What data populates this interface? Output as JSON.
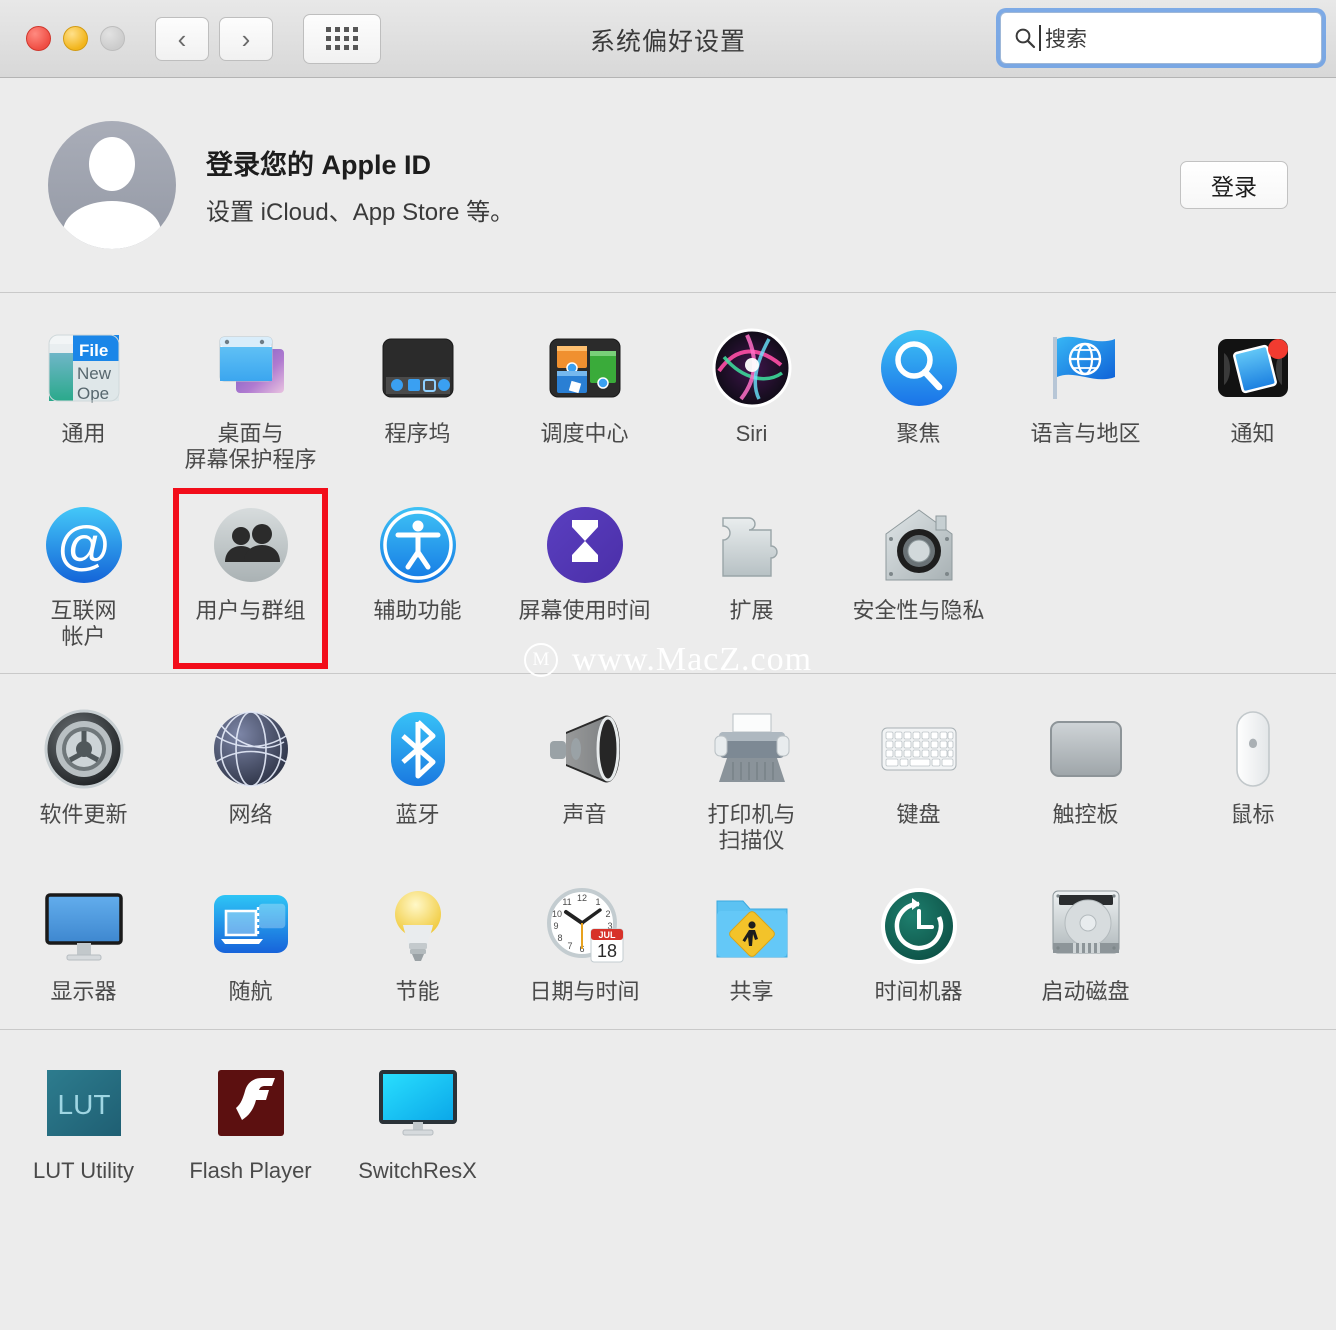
{
  "window": {
    "title": "系统偏好设置",
    "traffic_lights": [
      "close-red",
      "minimize-yellow",
      "zoom-disabled"
    ],
    "nav": {
      "back": "‹",
      "forward": "›",
      "grid": "grid-icon"
    },
    "search": {
      "placeholder": "搜索",
      "value": "",
      "icon": "search-icon",
      "focused": true
    }
  },
  "apple_id": {
    "title": "登录您的 Apple ID",
    "subtitle": "设置 iCloud、App Store 等。",
    "button": "登录",
    "avatar": "default-user-avatar"
  },
  "watermark": {
    "logo": "circled-m-logo",
    "text": "www.MacZ.com"
  },
  "highlight": {
    "target": "用户与群组",
    "color": "#f20d1a"
  },
  "sections": [
    {
      "id": "personal",
      "items": [
        {
          "label": "通用",
          "icon": "general-icon"
        },
        {
          "label": "桌面与\n屏幕保护程序",
          "icon": "desktop-screensaver-icon"
        },
        {
          "label": "程序坞",
          "icon": "dock-icon"
        },
        {
          "label": "调度中心",
          "icon": "mission-control-icon"
        },
        {
          "label": "Siri",
          "icon": "siri-icon"
        },
        {
          "label": "聚焦",
          "icon": "spotlight-icon"
        },
        {
          "label": "语言与地区",
          "icon": "language-region-icon"
        },
        {
          "label": "通知",
          "icon": "notifications-icon"
        },
        {
          "label": "互联网\n帐户",
          "icon": "internet-accounts-icon"
        },
        {
          "label": "用户与群组",
          "icon": "users-groups-icon",
          "highlighted": true
        },
        {
          "label": "辅助功能",
          "icon": "accessibility-icon"
        },
        {
          "label": "屏幕使用时间",
          "icon": "screen-time-icon"
        },
        {
          "label": "扩展",
          "icon": "extensions-icon"
        },
        {
          "label": "安全性与隐私",
          "icon": "security-privacy-icon"
        },
        {
          "label": "",
          "icon": "empty"
        },
        {
          "label": "",
          "icon": "empty"
        }
      ]
    },
    {
      "id": "hardware",
      "items": [
        {
          "label": "软件更新",
          "icon": "software-update-icon"
        },
        {
          "label": "网络",
          "icon": "network-icon"
        },
        {
          "label": "蓝牙",
          "icon": "bluetooth-icon"
        },
        {
          "label": "声音",
          "icon": "sound-icon"
        },
        {
          "label": "打印机与\n扫描仪",
          "icon": "printers-scanners-icon"
        },
        {
          "label": "键盘",
          "icon": "keyboard-icon"
        },
        {
          "label": "触控板",
          "icon": "trackpad-icon"
        },
        {
          "label": "鼠标",
          "icon": "mouse-icon"
        },
        {
          "label": "显示器",
          "icon": "displays-icon"
        },
        {
          "label": "随航",
          "icon": "sidecar-icon"
        },
        {
          "label": "节能",
          "icon": "energy-saver-icon"
        },
        {
          "label": "日期与时间",
          "icon": "date-time-icon"
        },
        {
          "label": "共享",
          "icon": "sharing-icon"
        },
        {
          "label": "时间机器",
          "icon": "time-machine-icon"
        },
        {
          "label": "启动磁盘",
          "icon": "startup-disk-icon"
        },
        {
          "label": "",
          "icon": "empty"
        }
      ]
    },
    {
      "id": "third-party",
      "items": [
        {
          "label": "LUT Utility",
          "icon": "lut-utility-icon"
        },
        {
          "label": "Flash Player",
          "icon": "flash-player-icon"
        },
        {
          "label": "SwitchResX",
          "icon": "switchresx-icon"
        }
      ]
    }
  ],
  "date_time_icon_text": {
    "month": "JUL",
    "day": "18"
  },
  "general_icon_text": {
    "file": "File",
    "new": "New",
    "open": "Ope"
  },
  "lut_icon_text": "LUT"
}
